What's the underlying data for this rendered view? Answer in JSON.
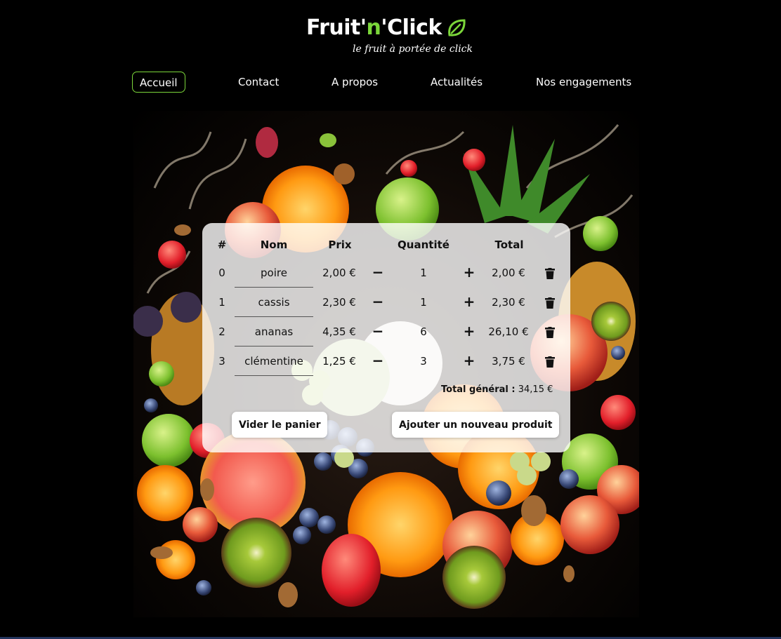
{
  "brand": {
    "name_part1": "Fruit'",
    "name_part2": "n",
    "name_part3": "'Click",
    "tagline": "le fruit à portée de click",
    "accent_color": "#7bd63a",
    "logo_icon": "leaf-icon"
  },
  "nav": {
    "items": [
      {
        "label": "Accueil",
        "active": true
      },
      {
        "label": "Contact",
        "active": false
      },
      {
        "label": "A propos",
        "active": false
      },
      {
        "label": "Actualités",
        "active": false
      },
      {
        "label": "Nos engagements",
        "active": false
      }
    ]
  },
  "cart": {
    "headers": {
      "index": "#",
      "name": "Nom",
      "price": "Prix",
      "quantity": "Quantité",
      "total": "Total"
    },
    "rows": [
      {
        "index": "0",
        "name": "poire",
        "price": "2,00 €",
        "quantity": "1",
        "total": "2,00 €"
      },
      {
        "index": "1",
        "name": "cassis",
        "price": "2,30 €",
        "quantity": "1",
        "total": "2,30 €"
      },
      {
        "index": "2",
        "name": "ananas",
        "price": "4,35 €",
        "quantity": "6",
        "total": "26,10 €"
      },
      {
        "index": "3",
        "name": "clémentine",
        "price": "1,25 €",
        "quantity": "3",
        "total": "3,75 €"
      }
    ],
    "decrement_symbol": "−",
    "increment_symbol": "+",
    "delete_icon": "trash-icon",
    "grand_total_label": "Total général :",
    "grand_total_value": "34,15 €",
    "clear_button": "Vider le panier",
    "add_button": "Ajouter un nouveau produit"
  }
}
